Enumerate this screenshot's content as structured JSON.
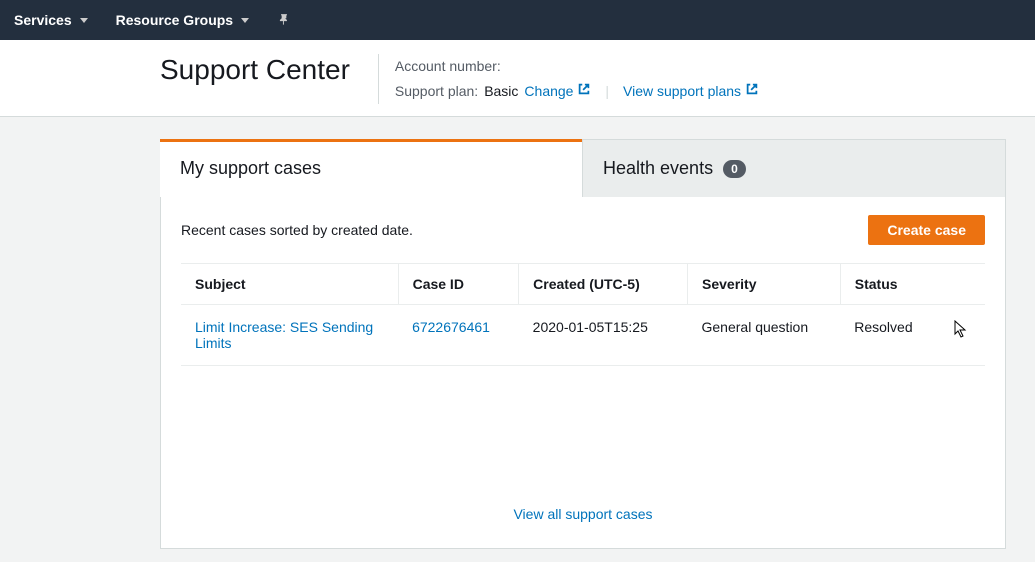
{
  "nav": {
    "services": "Services",
    "resource_groups": "Resource Groups"
  },
  "header": {
    "title": "Support Center",
    "account_number_label": "Account number:",
    "support_plan_label": "Support plan:",
    "support_plan_value": "Basic",
    "change_link": "Change",
    "view_plans_link": "View support plans"
  },
  "tabs": {
    "cases": "My support cases",
    "health": "Health events",
    "health_count": "0"
  },
  "panel": {
    "recent_text": "Recent cases sorted by created date.",
    "create_button": "Create case",
    "view_all": "View all support cases"
  },
  "table": {
    "headers": {
      "subject": "Subject",
      "case_id": "Case ID",
      "created": "Created (UTC-5)",
      "severity": "Severity",
      "status": "Status"
    },
    "rows": [
      {
        "subject": "Limit Increase: SES Sending Limits",
        "case_id": "6722676461",
        "created": "2020-01-05T15:25",
        "severity": "General question",
        "status": "Resolved"
      }
    ]
  }
}
